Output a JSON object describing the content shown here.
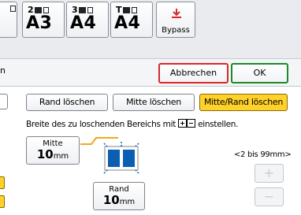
{
  "trays": [
    {
      "number": "2",
      "size": "A3"
    },
    {
      "number": "3",
      "size": "A4"
    },
    {
      "number": "T",
      "size": "A4"
    }
  ],
  "bypass": {
    "label": "Bypass",
    "icon": "bypass-tray-icon"
  },
  "actions": {
    "cancel": "Abbrechen",
    "ok": "OK"
  },
  "tabs": [
    {
      "label": "Rand löschen",
      "selected": false
    },
    {
      "label": "Mitte löschen",
      "selected": false
    },
    {
      "label": "Mitte/Rand löschen",
      "selected": true
    }
  ],
  "instruction": {
    "before": "Breite des zu loschenden Bereichs mit",
    "after": "einstellen."
  },
  "center_width": {
    "label": "Mitte",
    "value": "10",
    "unit": "mm"
  },
  "edge_width": {
    "label": "Rand",
    "value": "10",
    "unit": "mm"
  },
  "range": "<2 bis 99mm>",
  "steppers": {
    "plus": "+",
    "minus": "−"
  },
  "left_edge": {
    "partial_char": "n"
  },
  "colors": {
    "selected": "#ffd12a",
    "cancel_border": "#d9272e",
    "ok_border": "#1a8a2c",
    "diagram_blue": "#0b5fb3",
    "center_line": "#f0a818"
  }
}
